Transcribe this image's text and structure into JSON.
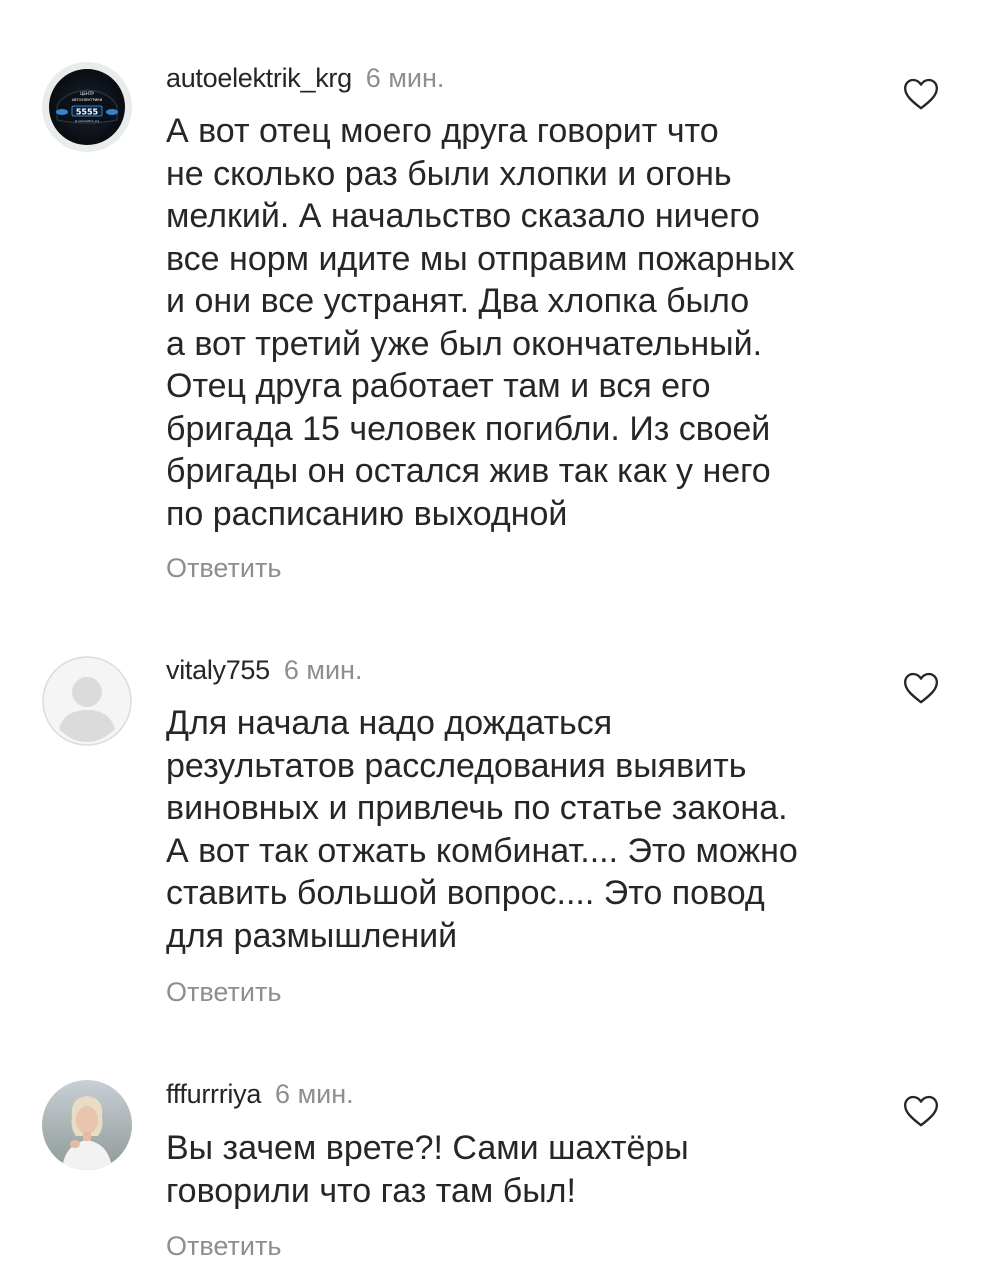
{
  "comments": [
    {
      "username": "autoelektrik_krg",
      "time": "6 мин.",
      "text": "А вот отец моего друга говорит что\nне сколько раз были хлопки и огонь\nмелкий. А начальство сказало ничего\nвсе норм идите мы отправим пожарных\nи они все устранят. Два хлопка было\nа вот третий уже был окончательный.\nОтец друга работает там и вся его\nбригада 15 человек погибли. Из своей\nбригады он остался жив так как у него\nпо расписанию выходной",
      "reply_label": "Ответить",
      "avatar_text": {
        "line1": "ЦЕНТР",
        "line2": "АВТОЭЛЕКТРИКИ",
        "number": "5555",
        "handle": "@ autoelektrik_krg"
      }
    },
    {
      "username": "vitaly755",
      "time": "6 мин.",
      "text": "Для начала надо дождаться\nрезультатов расследования выявить\nвиновных и привлечь по статье закона.\nА вот так отжать комбинат.... Это можно\nставить большой вопрос.... Это повод\nдля размышлений",
      "reply_label": "Ответить"
    },
    {
      "username": "fffurrriya",
      "time": "6 мин.",
      "text": "Вы зачем врете?! Сами шахтёры\nговорили что газ там был!",
      "reply_label": "Ответить"
    }
  ],
  "icons": {
    "like": "heart-outline-icon",
    "default_avatar": "default-user-avatar-icon"
  },
  "colors": {
    "text_primary": "#262626",
    "text_secondary": "#8e8e8e",
    "background": "#ffffff"
  }
}
